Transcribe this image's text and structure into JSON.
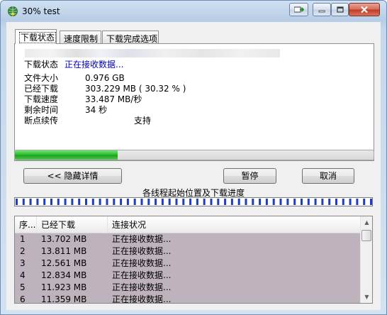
{
  "window": {
    "title": "30% test",
    "app_icon": "globe-download-icon",
    "controls": {
      "extra_icon": "arrow-right-icon",
      "minimize_icon": "minimize-icon",
      "maximize_icon": "maximize-icon",
      "close_icon": "close-icon"
    }
  },
  "tabs": [
    {
      "label": "下载状态",
      "active": true
    },
    {
      "label": "速度限制",
      "active": false
    },
    {
      "label": "下载完成选项",
      "active": false
    }
  ],
  "status": {
    "status_label": "下载状态",
    "status_value": "正在接收数据...",
    "rows": [
      {
        "label": "文件大小",
        "value": "0.976  GB"
      },
      {
        "label": "已经下载",
        "value": "303.229  MB  ( 30.32 % )"
      },
      {
        "label": "下载速度",
        "value": "33.487  MB/秒"
      },
      {
        "label": "剩余时间",
        "value": "34 秒"
      },
      {
        "label": "断点续传",
        "value": "支持"
      }
    ]
  },
  "progress": {
    "fraction": 0.2867,
    "color": "#2bb52b"
  },
  "buttons": {
    "hide_details": "<< 隐藏详情",
    "pause": "暂停",
    "cancel": "取消"
  },
  "threads": {
    "label": "各线程起始位置及下载进度",
    "count": 52,
    "marker_color": "#1b3fbf",
    "accent_color": "#d01010"
  },
  "list": {
    "columns": [
      "序...",
      "已经下载",
      "连接状况"
    ],
    "rows": [
      {
        "index": "1",
        "downloaded": "13.702  MB",
        "status": "正在接收数据..."
      },
      {
        "index": "2",
        "downloaded": "13.811  MB",
        "status": "正在接收数据..."
      },
      {
        "index": "3",
        "downloaded": "12.561  MB",
        "status": "正在接收数据..."
      },
      {
        "index": "4",
        "downloaded": "12.834  MB",
        "status": "正在接收数据..."
      },
      {
        "index": "5",
        "downloaded": "11.923  MB",
        "status": "正在接收数据..."
      },
      {
        "index": "6",
        "downloaded": "11.359  MB",
        "status": "正在接收数据..."
      }
    ],
    "row_background": "#beb3bd"
  }
}
